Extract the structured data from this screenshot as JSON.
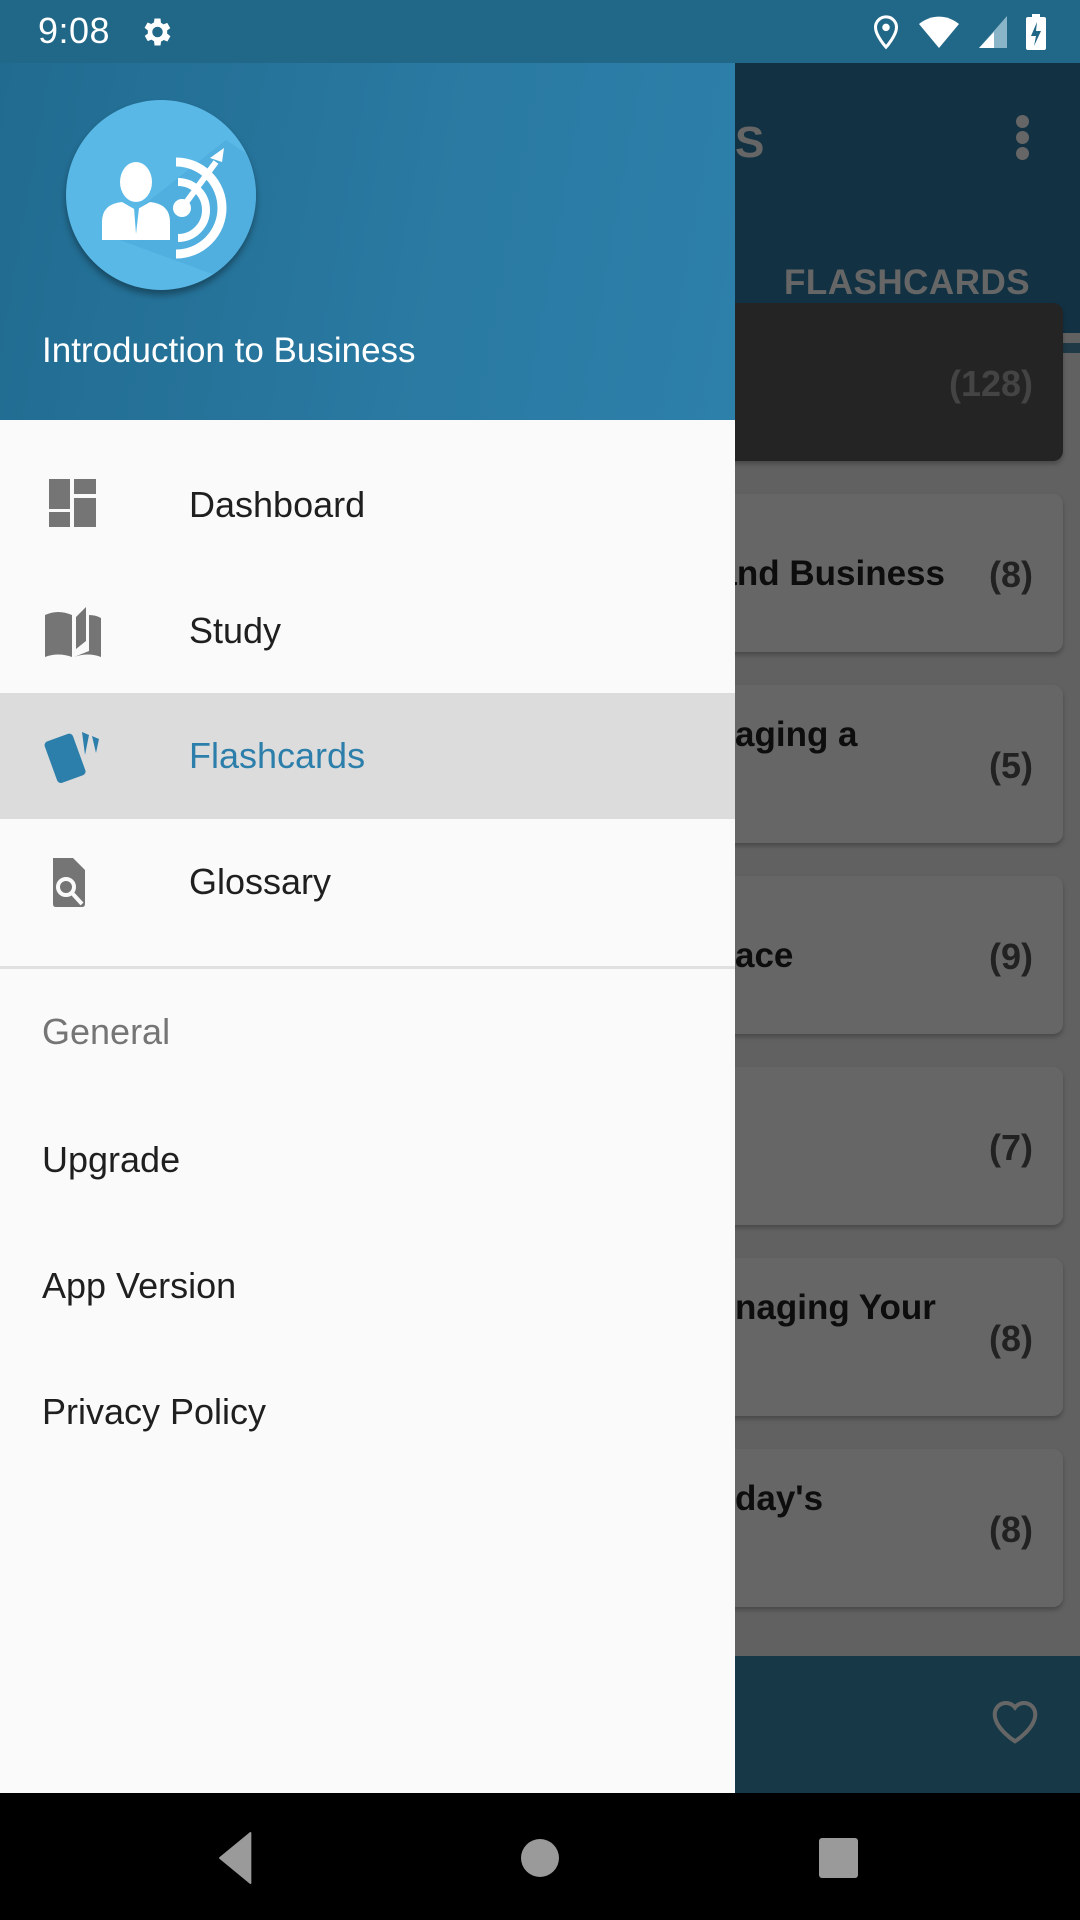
{
  "status_bar": {
    "time": "9:08",
    "left_icons": [
      "gear-icon"
    ],
    "right_icons": [
      "location-icon",
      "wifi-icon",
      "cell-signal-icon",
      "battery-charging-icon"
    ]
  },
  "background_app": {
    "title_fragment": "S",
    "overflow_icon": "more-vert-icon",
    "tab_label": "FLASHCARDS",
    "list_items": [
      {
        "title": "",
        "count": "(128)",
        "active": true
      },
      {
        "title": "and Business",
        "count": "(8)"
      },
      {
        "title": "aging a",
        "count": "(5)"
      },
      {
        "title": "ace",
        "count": "(9)"
      },
      {
        "title": "",
        "count": "(7)"
      },
      {
        "title": "naging Your",
        "count": "(8)"
      },
      {
        "title": "day's",
        "count": "(8)"
      }
    ],
    "bottom_bar_icon": "heart-outline-icon"
  },
  "drawer": {
    "header": {
      "app_name": "Introduction to Business",
      "logo_icon": "businessman-target-icon"
    },
    "nav_items": [
      {
        "label": "Dashboard",
        "icon": "dashboard-icon",
        "selected": false
      },
      {
        "label": "Study",
        "icon": "book-open-icon",
        "selected": false
      },
      {
        "label": "Flashcards",
        "icon": "flashcards-icon",
        "selected": true
      },
      {
        "label": "Glossary",
        "icon": "document-search-icon",
        "selected": false
      }
    ],
    "section_header": "General",
    "general_items": [
      {
        "label": "Upgrade"
      },
      {
        "label": "App Version"
      },
      {
        "label": "Privacy Policy"
      }
    ]
  },
  "nav_bar": {
    "buttons": [
      "back",
      "home",
      "recents"
    ]
  },
  "colors": {
    "primary": "#2d7fab",
    "status_bar": "#216787",
    "selected_item_bg": "#dcdcdc",
    "drawer_bg": "#fafafa"
  }
}
